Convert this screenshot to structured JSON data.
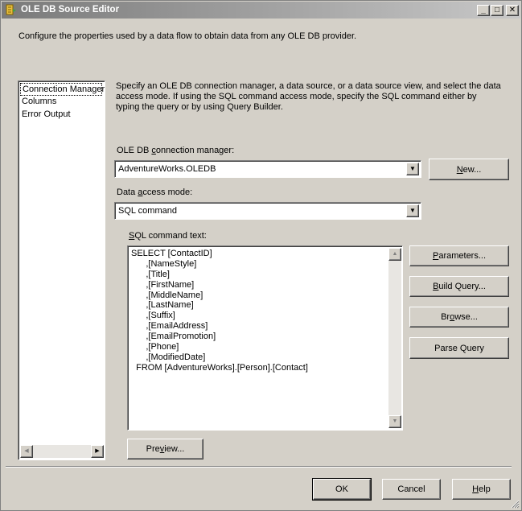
{
  "window": {
    "title": "OLE DB Source Editor",
    "caption_buttons": [
      "_",
      "□",
      "✕"
    ]
  },
  "header": {
    "description": "Configure the properties used by a data flow to obtain data from any OLE DB provider."
  },
  "sidebar": {
    "items": [
      {
        "label": "Connection Manager",
        "selected": true
      },
      {
        "label": "Columns",
        "selected": false
      },
      {
        "label": "Error Output",
        "selected": false
      }
    ]
  },
  "main": {
    "instructions": "Specify an OLE DB connection manager, a data source, or a data source view, and select the data access mode. If using the SQL command access mode, specify the SQL command either by typing the query or by using Query Builder.",
    "connection_label_pre": "OLE DB ",
    "connection_label_u": "c",
    "connection_label_post": "onnection manager:",
    "connection_value": "AdventureWorks.OLEDB",
    "new_button_u": "N",
    "new_button_post": "ew...",
    "access_label_pre": "Data ",
    "access_label_u": "a",
    "access_label_post": "ccess mode:",
    "access_value": "SQL command",
    "sql_label_u": "S",
    "sql_label_post": "QL command text:",
    "sql_lines": [
      "SELECT [ContactID]",
      "      ,[NameStyle]",
      "      ,[Title]",
      "      ,[FirstName]",
      "      ,[MiddleName]",
      "      ,[LastName]",
      "      ,[Suffix]",
      "      ,[EmailAddress]",
      "      ,[EmailPromotion]",
      "      ,[Phone]",
      "      ,[ModifiedDate]",
      "  FROM [AdventureWorks].[Person].[Contact]"
    ],
    "parameters_button_u": "P",
    "parameters_button_post": "arameters...",
    "build_query_button_u": "B",
    "build_query_button_post": "uild Query...",
    "browse_button_pre": "Br",
    "browse_button_u": "o",
    "browse_button_post": "wse...",
    "parse_query_button": "Parse Query",
    "preview_button_pre": "Pre",
    "preview_button_u": "v",
    "preview_button_post": "iew..."
  },
  "footer": {
    "ok_label": "OK",
    "cancel_label": "Cancel",
    "help_u": "H",
    "help_post": "elp"
  },
  "icons": {
    "window_icon": "ssis-source-icon",
    "combo_arrow": "chevron-down-icon",
    "scroll_up": "scroll-up-arrow-icon",
    "scroll_down": "scroll-down-arrow-icon",
    "scroll_left": "scroll-left-arrow-icon",
    "scroll_right": "scroll-right-arrow-icon"
  },
  "colors": {
    "face": "#d4d0c8",
    "title_gradient_start": "#7a7a7a",
    "title_gradient_end": "#c8c8c8"
  }
}
